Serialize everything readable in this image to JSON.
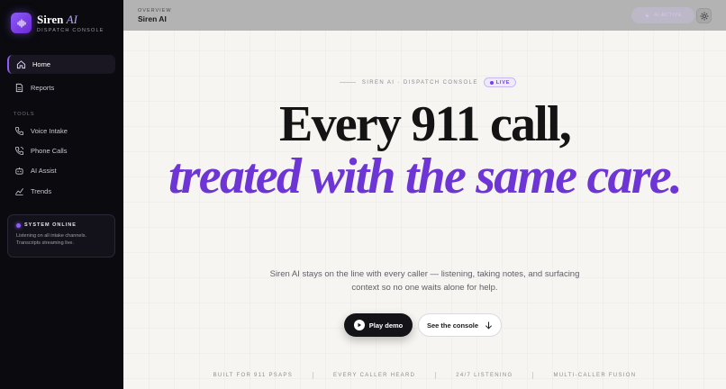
{
  "brand": {
    "name": "Siren",
    "name_accent": "AI",
    "subtitle": "DISPATCH CONSOLE"
  },
  "sidebar": {
    "items": [
      {
        "label": "Home",
        "icon": "home-icon",
        "active": true
      },
      {
        "label": "Reports",
        "icon": "document-icon"
      }
    ],
    "tools_label": "TOOLS",
    "tools": [
      {
        "label": "Voice Intake",
        "icon": "phone-icon"
      },
      {
        "label": "Phone Calls",
        "icon": "phone-calls-icon"
      },
      {
        "label": "AI Assist",
        "icon": "robot-icon"
      },
      {
        "label": "Trends",
        "icon": "trend-icon"
      }
    ],
    "status": {
      "title": "SYSTEM ONLINE",
      "line1": "Listening on all intake channels.",
      "line2": "Transcripts streaming live."
    }
  },
  "topbar": {
    "overview_label": "OVERVIEW",
    "title": "Siren AI",
    "live_label": "AI ACTIVE"
  },
  "hero": {
    "eyebrow": "SIREN AI · DISPATCH CONSOLE",
    "live_badge": "LIVE",
    "headline": "Every 911 call,",
    "headline_accent": "treated with the same care.",
    "subtext": "Siren AI stays on the line with every caller — listening, taking notes, and surfacing context so no one waits alone for help.",
    "primary_button": "Play demo",
    "secondary_button": "See the console"
  },
  "footer": {
    "items": [
      "BUILT FOR 911 PSAPS",
      "EVERY CALLER HEARD",
      "24/7 LISTENING",
      "MULTI-CALLER FUSION"
    ]
  },
  "colors": {
    "accent": "#6d35d6",
    "sidebar_bg": "#0a0a0f",
    "main_bg": "#f7f5f1"
  }
}
